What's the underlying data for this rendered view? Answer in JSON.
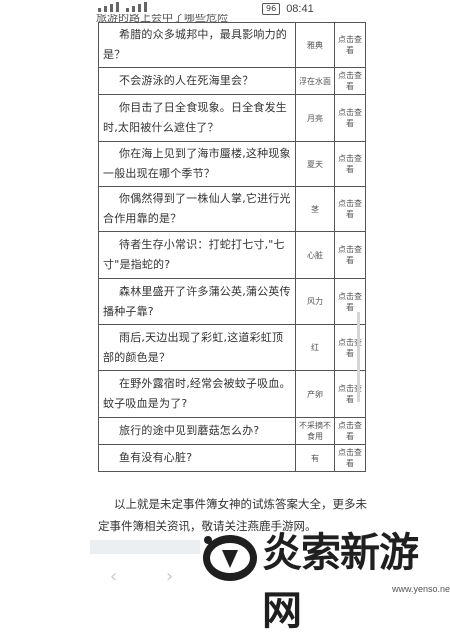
{
  "status_bar": {
    "battery": "96",
    "time": "08:41"
  },
  "cut_row_text": "旅游的路上会中了哪些危险",
  "rows": [
    {
      "question": "希腊的众多城邦中，最具影响力的是？",
      "answer": "雅典",
      "view": "点击查看"
    },
    {
      "question": "不会游泳的人在死海里会？",
      "answer": "浮在水面",
      "view": "点击查看"
    },
    {
      "question": "你目击了日全食现象。日全食发生时,太阳被什么遮住了？",
      "answer": "月亮",
      "view": "点击查看"
    },
    {
      "question": "你在海上见到了海市蜃楼,这种现象一般出现在哪个季节？",
      "answer": "夏天",
      "view": "点击查看"
    },
    {
      "question": "你偶然得到了一株仙人掌,它进行光合作用靠的是？",
      "answer": "茎",
      "view": "点击查看"
    },
    {
      "question": "待者生存小常识：打蛇打七寸,\"七寸\"是指蛇的?",
      "answer": "心脏",
      "view": "点击查看"
    },
    {
      "question": "森林里盛开了许多蒲公英,蒲公英传播种子靠?",
      "answer": "风力",
      "view": "点击查看"
    },
    {
      "question": "雨后,天边出现了彩虹,这道彩虹顶部的颜色是？",
      "answer": "红",
      "view": "点击查看"
    },
    {
      "question": "在野外露宿时,经常会被蚊子吸血。蚊子吸血是为了?",
      "answer": "产卵",
      "view": "点击查看"
    },
    {
      "question": "旅行的途中见到蘑菇怎么办?",
      "answer": "不采摘不食用",
      "view": "点击查看"
    },
    {
      "question": "鱼有没有心脏?",
      "answer": "有",
      "view": "点击查看"
    }
  ],
  "footer_text": "以上就是未定事件簿女神的试炼答案大全，更多未定事件簿相关资讯，敬请关注燕鹿手游网。",
  "watermark": {
    "title": "炎索新游网",
    "url": "www.yenso.net"
  },
  "nav": {
    "back": "‹",
    "forward": "›"
  }
}
